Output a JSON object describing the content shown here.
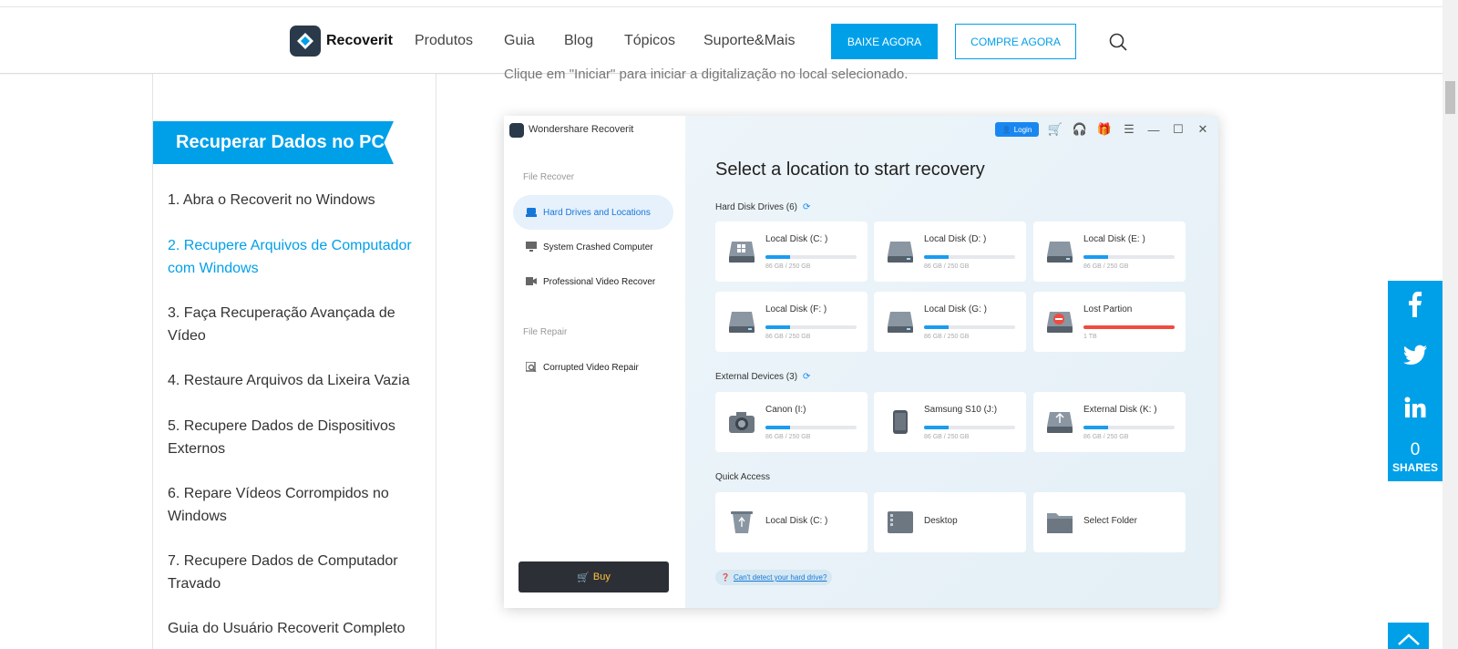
{
  "header": {
    "brand": "Recoverit",
    "nav": [
      "Produtos",
      "Guia",
      "Blog",
      "Tópicos",
      "Suporte&Mais"
    ],
    "download_label": "BAIXE AGORA",
    "buy_label": "COMPRE AGORA"
  },
  "sidebar": {
    "title": "Recuperar Dados no PC",
    "items": [
      "1. Abra o Recoverit no Windows",
      "2. Recupere Arquivos de Computador com Windows",
      "3. Faça Recuperação Avançada de Vídeo",
      "4. Restaure Arquivos da Lixeira Vazia",
      "5. Recupere Dados de Dispositivos Externos",
      "6. Repare Vídeos Corrompidos no Windows",
      "7. Recupere Dados de Computador Travado",
      "Guia do Usuário Recoverit Completo"
    ]
  },
  "content": {
    "caption": "Clique em \"Iniciar\" para iniciar a digitalização no local selecionado."
  },
  "app": {
    "title": "Wondershare Recoverit",
    "login": "Login",
    "sections": {
      "file_recover": "File Recover",
      "file_repair": "File Repair"
    },
    "nav": [
      "Hard Drives and Locations",
      "System Crashed Computer",
      "Professional Video Recover",
      "Corrupted Video Repair"
    ],
    "buy": "Buy",
    "heading": "Select a location to start recovery",
    "hard_disk_title": "Hard Disk Drives (6)",
    "external_title": "External Devices (3)",
    "quick_title": "Quick Access",
    "hard_disks": [
      {
        "name": "Local Disk (C: )",
        "size": "86 GB / 250 GB",
        "fill": 0.27
      },
      {
        "name": "Local Disk (D: )",
        "size": "86 GB / 250 GB",
        "fill": 0.27
      },
      {
        "name": "Local Disk (E: )",
        "size": "86 GB / 250 GB",
        "fill": 0.27
      },
      {
        "name": "Local Disk (F: )",
        "size": "86 GB / 250 GB",
        "fill": 0.27
      },
      {
        "name": "Local Disk (G: )",
        "size": "86 GB / 250 GB",
        "fill": 0.27
      },
      {
        "name": "Lost Partion",
        "size": "1 TB",
        "fill": 1.0
      }
    ],
    "external": [
      {
        "name": "Canon (I:)",
        "size": "86 GB / 250 GB",
        "fill": 0.27
      },
      {
        "name": "Samsung S10  (J:)",
        "size": "86 GB / 250 GB",
        "fill": 0.27
      },
      {
        "name": "External Disk (K: )",
        "size": "86 GB / 250 GB",
        "fill": 0.27
      }
    ],
    "quick": [
      "Local Disk (C: )",
      "Desktop",
      "Select Folder"
    ],
    "cant_detect": "Can't detect your hard drive?"
  },
  "share": {
    "count": "0",
    "label": "SHARES"
  },
  "colors": {
    "accent": "#00a0e9",
    "progress": "#1a9cf0",
    "lost": "#ef4b3f"
  }
}
